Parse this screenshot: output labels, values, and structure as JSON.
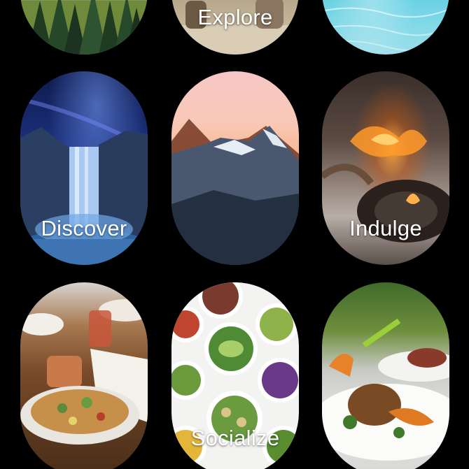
{
  "tiles": [
    {
      "id": "forest",
      "label": ""
    },
    {
      "id": "explore",
      "label": "Explore"
    },
    {
      "id": "water",
      "label": ""
    },
    {
      "id": "discover",
      "label": "Discover"
    },
    {
      "id": "mountain",
      "label": ""
    },
    {
      "id": "indulge",
      "label": "Indulge"
    },
    {
      "id": "restaurant",
      "label": ""
    },
    {
      "id": "socialize",
      "label": "Socialize"
    },
    {
      "id": "dish",
      "label": ""
    }
  ]
}
